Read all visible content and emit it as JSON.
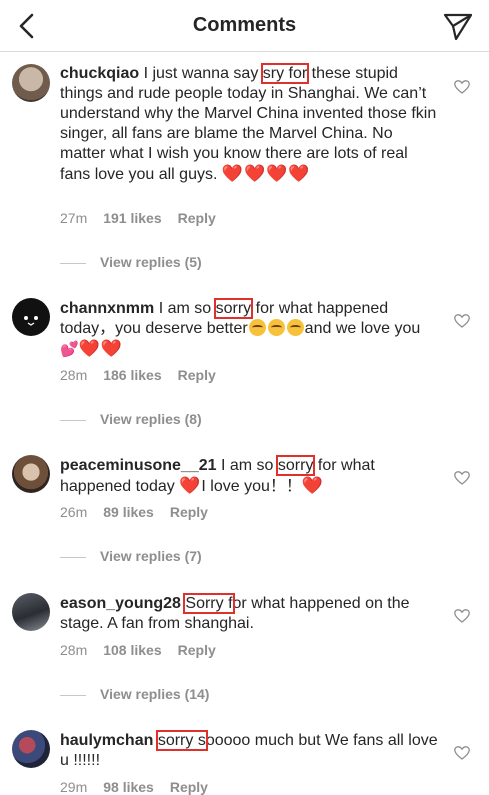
{
  "header": {
    "title": "Comments"
  },
  "comments": [
    {
      "user": "chuckqiao",
      "pre": " I just wanna say ",
      "highlight": "sry for",
      "post": " these stupid things and rude people today in Shanghai. We can’t understand why the Marvel China invented those fkin singer, all fans are blame the Marvel China. No matter what I wish you know there are lots of real fans love you all guys. ",
      "emoji": "❤️❤️❤️❤️",
      "time": "27m",
      "likes": "191 likes",
      "reply": "Reply",
      "view_replies": "View replies (5)"
    },
    {
      "user": "channxnmm",
      "pre": " I am so ",
      "highlight": "sorry",
      "post": " for what happened today，you deserve better",
      "post2": "and we love you",
      "emoji": "❤️❤️",
      "time": "28m",
      "likes": "186 likes",
      "reply": "Reply",
      "view_replies": "View replies (8)"
    },
    {
      "user": "peaceminusone__21",
      "pre": " I am so ",
      "highlight": "sorry",
      "post": " for what happened today ",
      "post2": "I love you！！",
      "emoji": "❤️",
      "time": "26m",
      "likes": "89 likes",
      "reply": "Reply",
      "view_replies": "View replies (7)"
    },
    {
      "user": "eason_young28",
      "pre": " ",
      "highlight": "Sorry f",
      "post": "or what happened on the stage. A fan from shanghai.",
      "time": "28m",
      "likes": "108 likes",
      "reply": "Reply",
      "view_replies": "View replies (14)"
    },
    {
      "user": "haulymchan",
      "pre": " ",
      "highlight": "sorry s",
      "post": "ooooo much but We fans all love u !!!!!!",
      "time": "29m",
      "likes": "98 likes",
      "reply": "Reply"
    }
  ],
  "colors": {
    "highlight_box": "#e0302c",
    "meta_gray": "#8e8e8e",
    "heart_red": "#e0232e"
  }
}
